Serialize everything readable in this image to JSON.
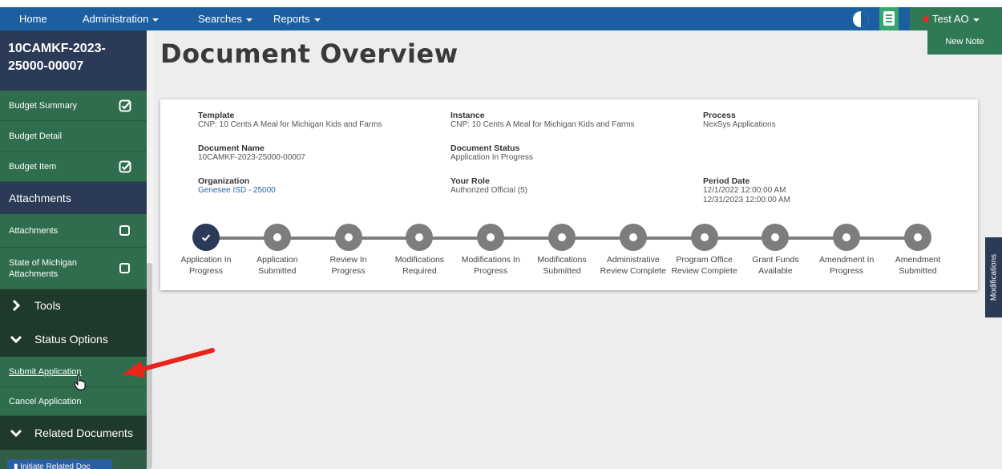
{
  "navbar": {
    "home": "Home",
    "administration": "Administration",
    "searches": "Searches",
    "reports": "Reports",
    "user": "Test AO",
    "icons": [
      "contrast-icon",
      "document-icon"
    ],
    "user_status_color": "#d9302c"
  },
  "sidebar": {
    "doc_id": "10CAMKF-2023-25000-00007",
    "items": [
      {
        "label": "Budget Summary",
        "status": "checked"
      },
      {
        "label": "Budget Detail"
      },
      {
        "label": "Budget Item",
        "status": "checked"
      },
      {
        "label": "Attachments"
      },
      {
        "label": "Attachments",
        "status": "unchecked"
      },
      {
        "label": "State of Michigan Attachments",
        "status": "unchecked"
      },
      {
        "label": "Tools",
        "icon": "chevron-right-icon"
      },
      {
        "label": "Status Options",
        "icon": "chevron-down-icon"
      },
      {
        "label": "Submit Application"
      },
      {
        "label": "Cancel Application"
      },
      {
        "label": "Related Documents",
        "icon": "chevron-down-icon"
      }
    ],
    "initiate_button": "Initiate Related Doc"
  },
  "main": {
    "title": "Document Overview",
    "new_note": "New Note",
    "side_tab": "Modifications"
  },
  "overview": {
    "template_label": "Template",
    "template_value": "CNP: 10 Cents A Meal for Michigan Kids and Farms",
    "instance_label": "Instance",
    "instance_value": "CNP: 10 Cents A Meal for Michigan Kids and Farms",
    "process_label": "Process",
    "process_value": "NexSys Applications",
    "doc_name_label": "Document Name",
    "doc_name_value": "10CAMKF-2023-25000-00007",
    "doc_status_label": "Document Status",
    "doc_status_value": "Application In Progress",
    "org_label": "Organization",
    "org_value": "Genesee ISD - 25000",
    "role_label": "Your Role",
    "role_value": "Authorized Official (5)",
    "period_label": "Period Date",
    "period_start": "12/1/2022 12:00:00 AM",
    "period_end": "12/31/2023 12:00:00 AM"
  },
  "timeline": {
    "completed_color": "#2b3a56",
    "steps": [
      {
        "l1": "Application In",
        "l2": "Progress",
        "done": true
      },
      {
        "l1": "Application",
        "l2": "Submitted"
      },
      {
        "l1": "Review In",
        "l2": "Progress"
      },
      {
        "l1": "Modifications",
        "l2": "Required"
      },
      {
        "l1": "Modifications In",
        "l2": "Progress"
      },
      {
        "l1": "Modifications",
        "l2": "Submitted"
      },
      {
        "l1": "Administrative",
        "l2": "Review Complete"
      },
      {
        "l1": "Program Office",
        "l2": "Review Complete"
      },
      {
        "l1": "Grant Funds",
        "l2": "Available"
      },
      {
        "l1": "Amendment In",
        "l2": "Progress"
      },
      {
        "l1": "Amendment",
        "l2": "Submitted"
      }
    ]
  },
  "annotation": {
    "arrow_color": "#e8241c",
    "icon": "red-arrow-icon"
  }
}
